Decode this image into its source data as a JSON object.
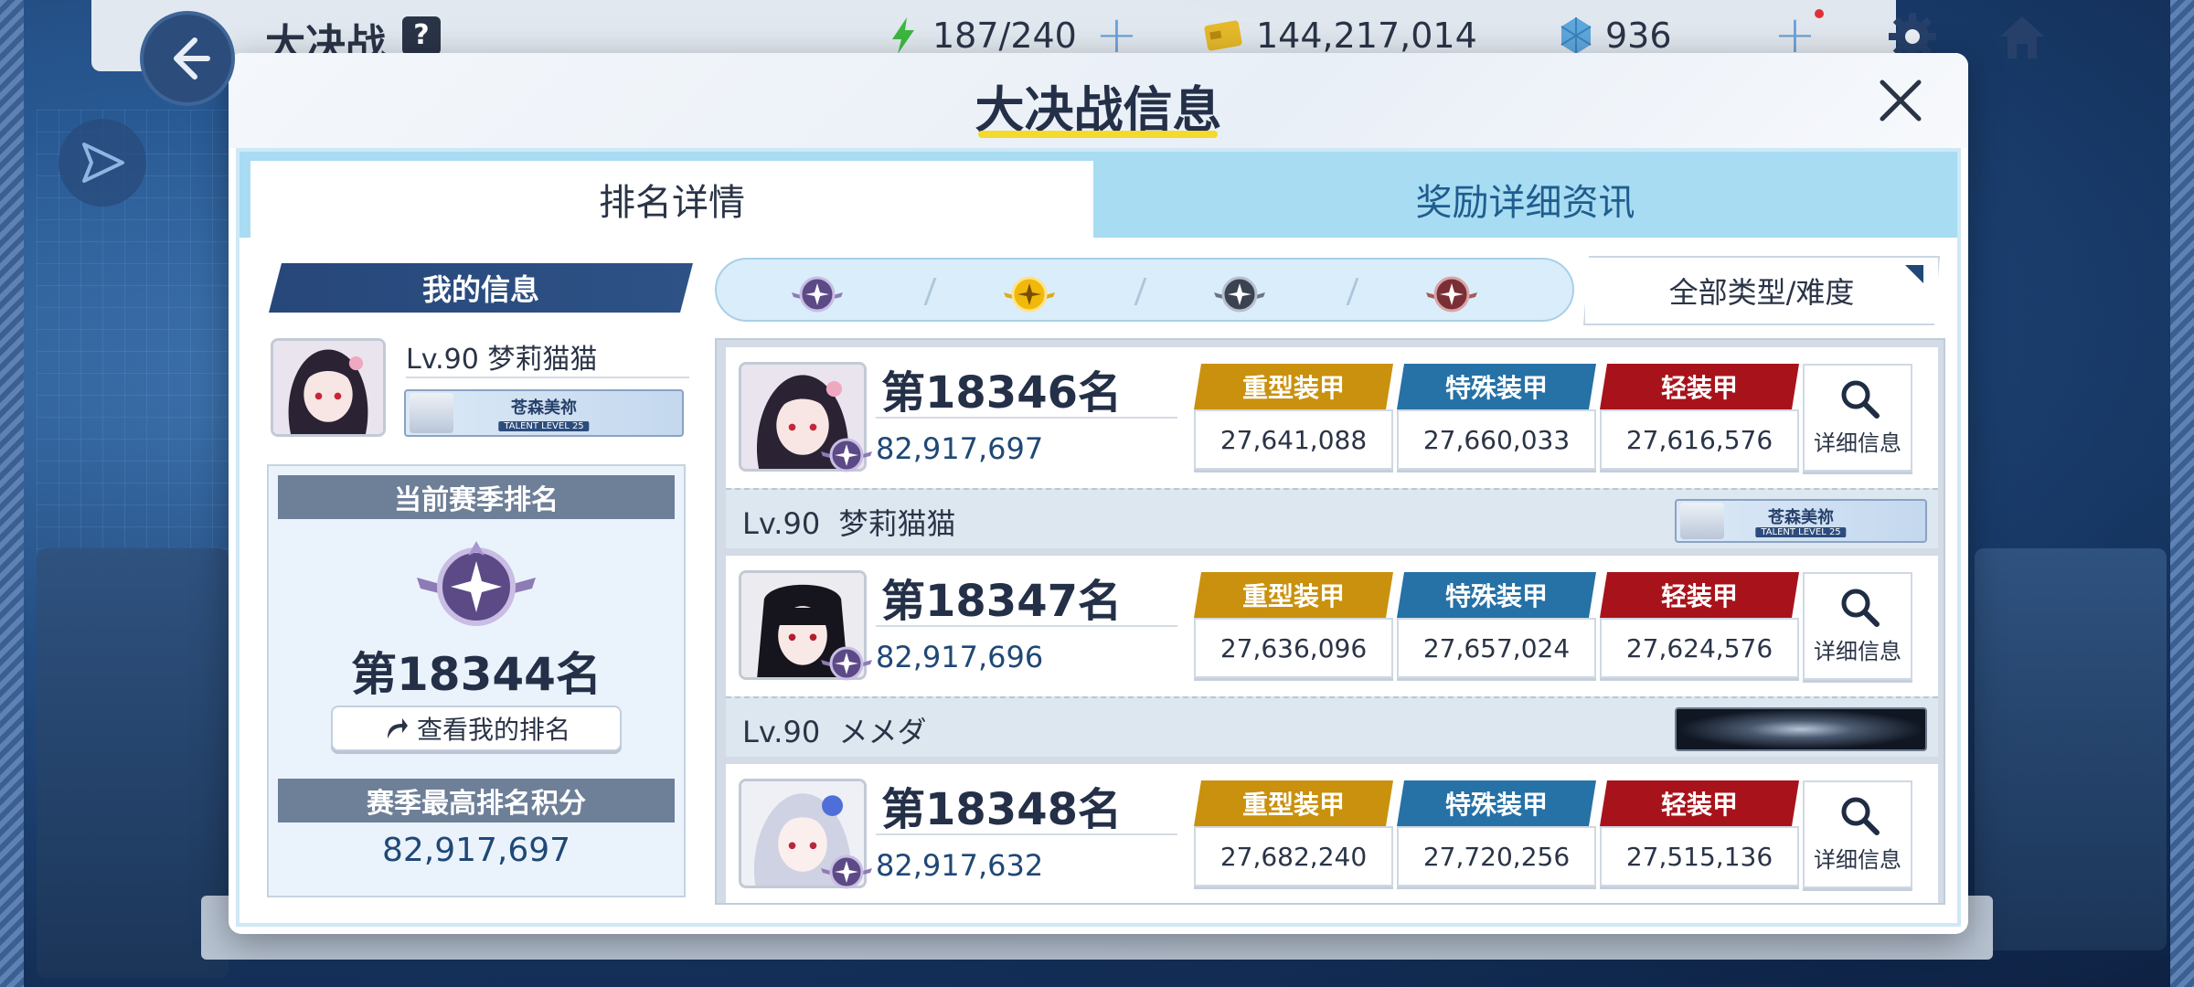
{
  "topbar": {
    "title": "大决战",
    "help": "?",
    "stamina": "187/240",
    "credits": "144,217,014",
    "gems": "936",
    "plus": "+"
  },
  "dialog": {
    "title": "大决战信息",
    "tabs": [
      "排名详情",
      "奖励详细资讯"
    ]
  },
  "my_info": {
    "header": "我的信息",
    "level_name": "Lv.90 梦莉猫猫",
    "banner_text": "苍森美祢",
    "banner_level": "TALENT LEVEL 25",
    "current_rank_header": "当前赛季排名",
    "current_rank": "第18344名",
    "view_my_rank": "查看我的排名",
    "best_score_header": "赛季最高排名积分",
    "best_score": "82,917,697"
  },
  "filter": {
    "difficulties": [
      "difficulty-purple",
      "difficulty-gold",
      "difficulty-dark",
      "difficulty-red"
    ],
    "type_select": "全部类型/难度"
  },
  "armor_labels": {
    "heavy": "重型装甲",
    "special": "特殊装甲",
    "light": "轻装甲",
    "detail": "详细信息"
  },
  "entries": [
    {
      "rank": "第18346名",
      "score": "82,917,697",
      "heavy": "27,641,088",
      "special": "27,660,033",
      "light": "27,616,576",
      "level": "Lv.90",
      "name": "梦莉猫猫",
      "banner_text": "苍森美祢",
      "banner_level": "TALENT LEVEL 25"
    },
    {
      "rank": "第18347名",
      "score": "82,917,696",
      "heavy": "27,636,096",
      "special": "27,657,024",
      "light": "27,624,576",
      "level": "Lv.90",
      "name": "メメダ"
    },
    {
      "rank": "第18348名",
      "score": "82,917,632",
      "heavy": "27,682,240",
      "special": "27,720,256",
      "light": "27,515,136"
    }
  ],
  "colors": {
    "heavy": "#c9910e",
    "special": "#2671a5",
    "light": "#a8131b",
    "header_dark": "#27477a",
    "tab_bg": "#a7dcf2",
    "title_underline": "#f3da2b"
  }
}
